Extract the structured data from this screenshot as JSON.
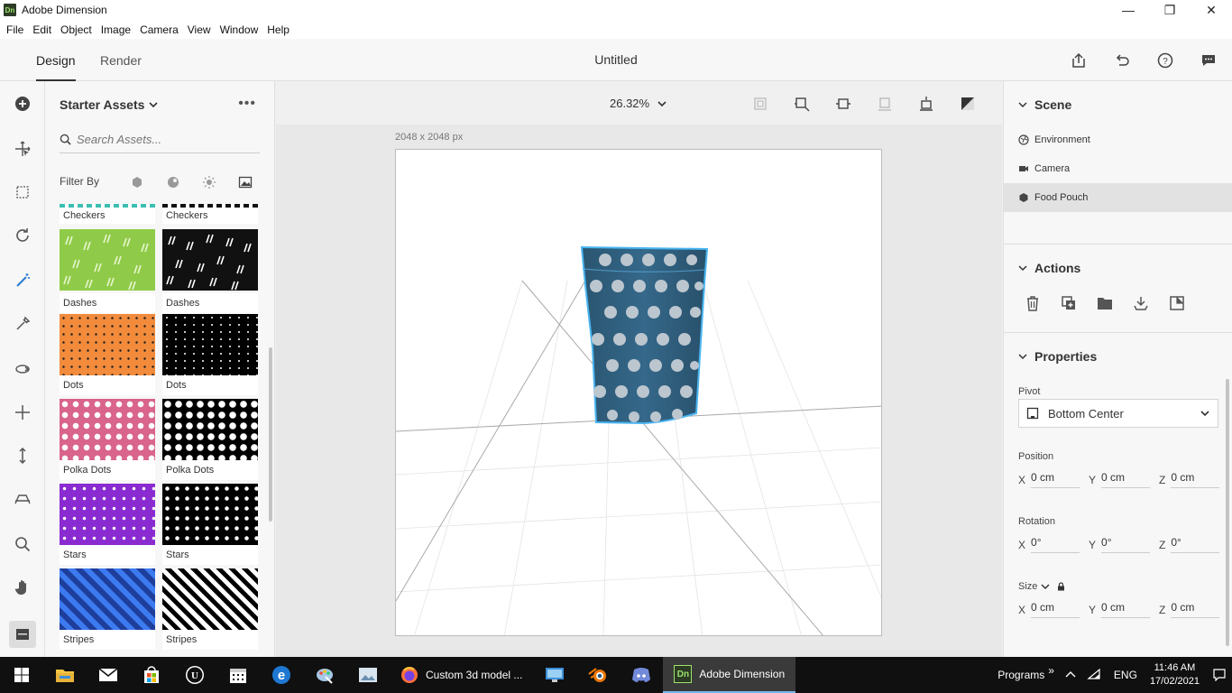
{
  "window": {
    "title": "Adobe Dimension",
    "logo_text": "Dn"
  },
  "menu": [
    "File",
    "Edit",
    "Object",
    "Image",
    "Camera",
    "View",
    "Window",
    "Help"
  ],
  "header": {
    "tabs": [
      "Design",
      "Render"
    ],
    "document_title": "Untitled"
  },
  "assets": {
    "title": "Starter Assets",
    "search_placeholder": "Search Assets...",
    "filter_label": "Filter By",
    "tiles": [
      {
        "label": "Checkers",
        "swatch": "checkers"
      },
      {
        "label": "Checkers",
        "swatch": "checkers-black"
      },
      {
        "label": "Dashes",
        "swatch": "dashes-green"
      },
      {
        "label": "Dashes",
        "swatch": "dashes-black"
      },
      {
        "label": "Dots",
        "swatch": "dots-orange"
      },
      {
        "label": "Dots",
        "swatch": "dots-black"
      },
      {
        "label": "Polka Dots",
        "swatch": "polka-pink"
      },
      {
        "label": "Polka Dots",
        "swatch": "polka-black"
      },
      {
        "label": "Stars",
        "swatch": "stars-purple"
      },
      {
        "label": "Stars",
        "swatch": "stars-black"
      },
      {
        "label": "Stripes",
        "swatch": "stripes-blue"
      },
      {
        "label": "Stripes",
        "swatch": "stripes-black"
      }
    ]
  },
  "canvas": {
    "zoom": "26.32%",
    "doc_size": "2048 x 2048 px"
  },
  "scene": {
    "title": "Scene",
    "items": [
      {
        "label": "Environment",
        "icon": "environment-icon",
        "selected": false
      },
      {
        "label": "Camera",
        "icon": "camera-icon",
        "selected": false
      },
      {
        "label": "Food Pouch",
        "icon": "model-icon",
        "selected": true
      }
    ]
  },
  "actions": {
    "title": "Actions"
  },
  "properties": {
    "title": "Properties",
    "pivot_label": "Pivot",
    "pivot_value": "Bottom Center",
    "position_label": "Position",
    "position": {
      "x": "0 cm",
      "y": "0 cm",
      "z": "0 cm"
    },
    "rotation_label": "Rotation",
    "rotation": {
      "x": "0°",
      "y": "0°",
      "z": "0°"
    },
    "size_label": "Size",
    "size": {
      "x": "0 cm",
      "y": "0 cm",
      "z": "0 cm"
    },
    "axis": {
      "x": "X",
      "y": "Y",
      "z": "Z"
    }
  },
  "taskbar": {
    "apps": [
      {
        "label": "Custom 3d model ...",
        "active": false
      },
      {
        "label": "Adobe Dimension",
        "active": true
      }
    ],
    "programs_label": "Programs",
    "lang": "ENG",
    "time": "11:46 AM",
    "date": "17/02/2021"
  },
  "colors": {
    "accent": "#3a9ad9",
    "pouch": "#2f5c78",
    "taskbar": "#101010"
  }
}
